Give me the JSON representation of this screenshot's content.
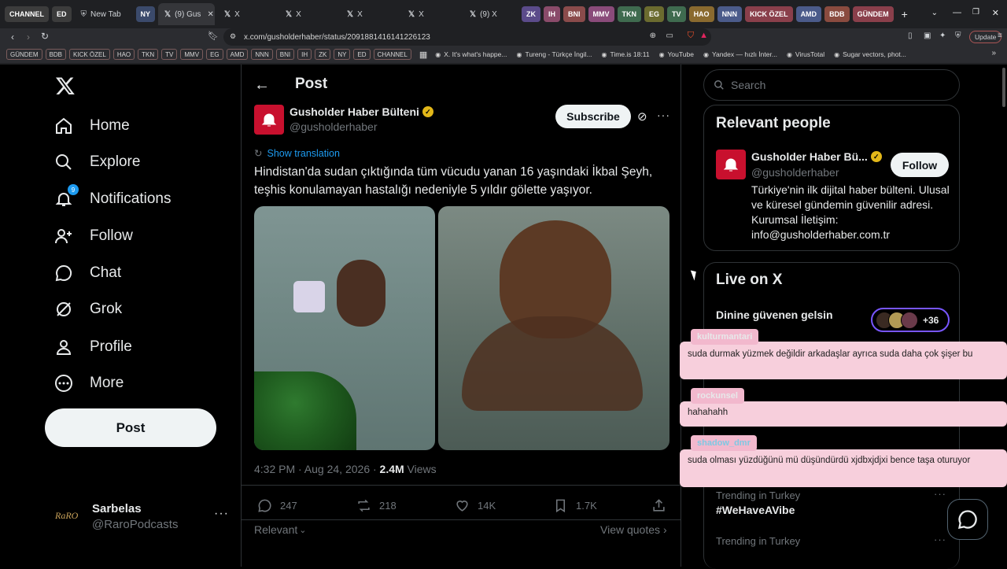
{
  "browser": {
    "tabs": [
      "CHANNEL",
      "ED",
      "New Tab",
      "NY",
      "(9) Gus",
      "X",
      "X",
      "X",
      "X",
      "(9) X"
    ],
    "group_pills": [
      {
        "label": "ZK",
        "color": "#5b4b8a"
      },
      {
        "label": "IH",
        "color": "#8a4b6a"
      },
      {
        "label": "BNI",
        "color": "#8a4b4b"
      },
      {
        "label": "MMV",
        "color": "#8a4b7a"
      },
      {
        "label": "TKN",
        "color": "#3f6b4f"
      },
      {
        "label": "EG",
        "color": "#6b6b2f"
      },
      {
        "label": "TV",
        "color": "#3f6b4f"
      },
      {
        "label": "HAO",
        "color": "#8a6a2f"
      },
      {
        "label": "NNN",
        "color": "#4b5b8a"
      },
      {
        "label": "KICK ÖZEL",
        "color": "#8a3f4b"
      },
      {
        "label": "AMD",
        "color": "#4b5b8a"
      },
      {
        "label": "BDB",
        "color": "#8a4b3f"
      },
      {
        "label": "GÜNDEM",
        "color": "#8a3f4b"
      }
    ],
    "url": "x.com/gusholderhaber/status/2091881416141226123",
    "update_label": "Update",
    "bookmark_pills": [
      "GÜNDEM",
      "BDB",
      "KICK ÖZEL",
      "HAO",
      "TKN",
      "TV",
      "MMV",
      "EG",
      "AMD",
      "NNN",
      "BNI",
      "IH",
      "ZK",
      "NY",
      "ED",
      "CHANNEL"
    ],
    "bookmarks": [
      "X. It's what's happe...",
      "Tureng - Türkçe İngil...",
      "Time.is 18:11",
      "YouTube",
      "Yandex — hızlı İnter...",
      "VirusTotal",
      "Sugar vectors, phot..."
    ]
  },
  "nav": {
    "items": [
      "Home",
      "Explore",
      "Notifications",
      "Follow",
      "Chat",
      "Grok",
      "Profile",
      "More"
    ],
    "notif_count": "9",
    "post_label": "Post",
    "account_name": "Sarbelas",
    "account_handle": "@RaroPodcasts",
    "account_logo": "RaRO"
  },
  "post": {
    "header": "Post",
    "author_name": "Gusholder Haber Bülteni",
    "author_handle": "@gusholderhaber",
    "subscribe_label": "Subscribe",
    "translate_label": "Show translation",
    "text": "Hindistan'da sudan çıktığında tüm vücudu yanan 16 yaşındaki İkbal Şeyh, teşhis konulamayan hastalığı nedeniyle 5 yıldır gölette yaşıyor.",
    "time": "4:32 PM · Aug 24, 2026 · ",
    "views_count": "2.4M",
    "views_label": " Views",
    "replies": "247",
    "reposts": "218",
    "likes": "14K",
    "bookmarks": "1.7K",
    "relevant_label": "Relevant",
    "view_quotes_label": "View quotes"
  },
  "right": {
    "search_placeholder": "Search",
    "relevant_people_title": "Relevant people",
    "person_name": "Gusholder Haber Bü...",
    "person_handle": "@gusholderhaber",
    "follow_label": "Follow",
    "bio": "Türkiye'nin ilk dijital haber bülteni. Ulusal ve küresel gündemin güvenilir adresi. Kurumsal İletişim: info@gusholderhaber.com.tr",
    "live_title": "Live on X",
    "live_item": "Dinine güvenen gelsin",
    "live_count": "+36",
    "trend1_meta": "Trending in Turkey",
    "trend1_tag": "#WeHaveAVibe",
    "trend2_meta": "Trending in Turkey"
  },
  "chat_overlay": [
    {
      "user": "kulturmantari",
      "message": "suda durmak yüzmek değildir arkadaşlar ayrıca suda daha çok şişer bu"
    },
    {
      "user": "rockunsel",
      "message": "hahahahh"
    },
    {
      "user": "shadow_dmr",
      "message": "suda olması yüzdüğünü mü düşündürdü xjdbxjdjxi bence taşa oturuyor"
    }
  ]
}
